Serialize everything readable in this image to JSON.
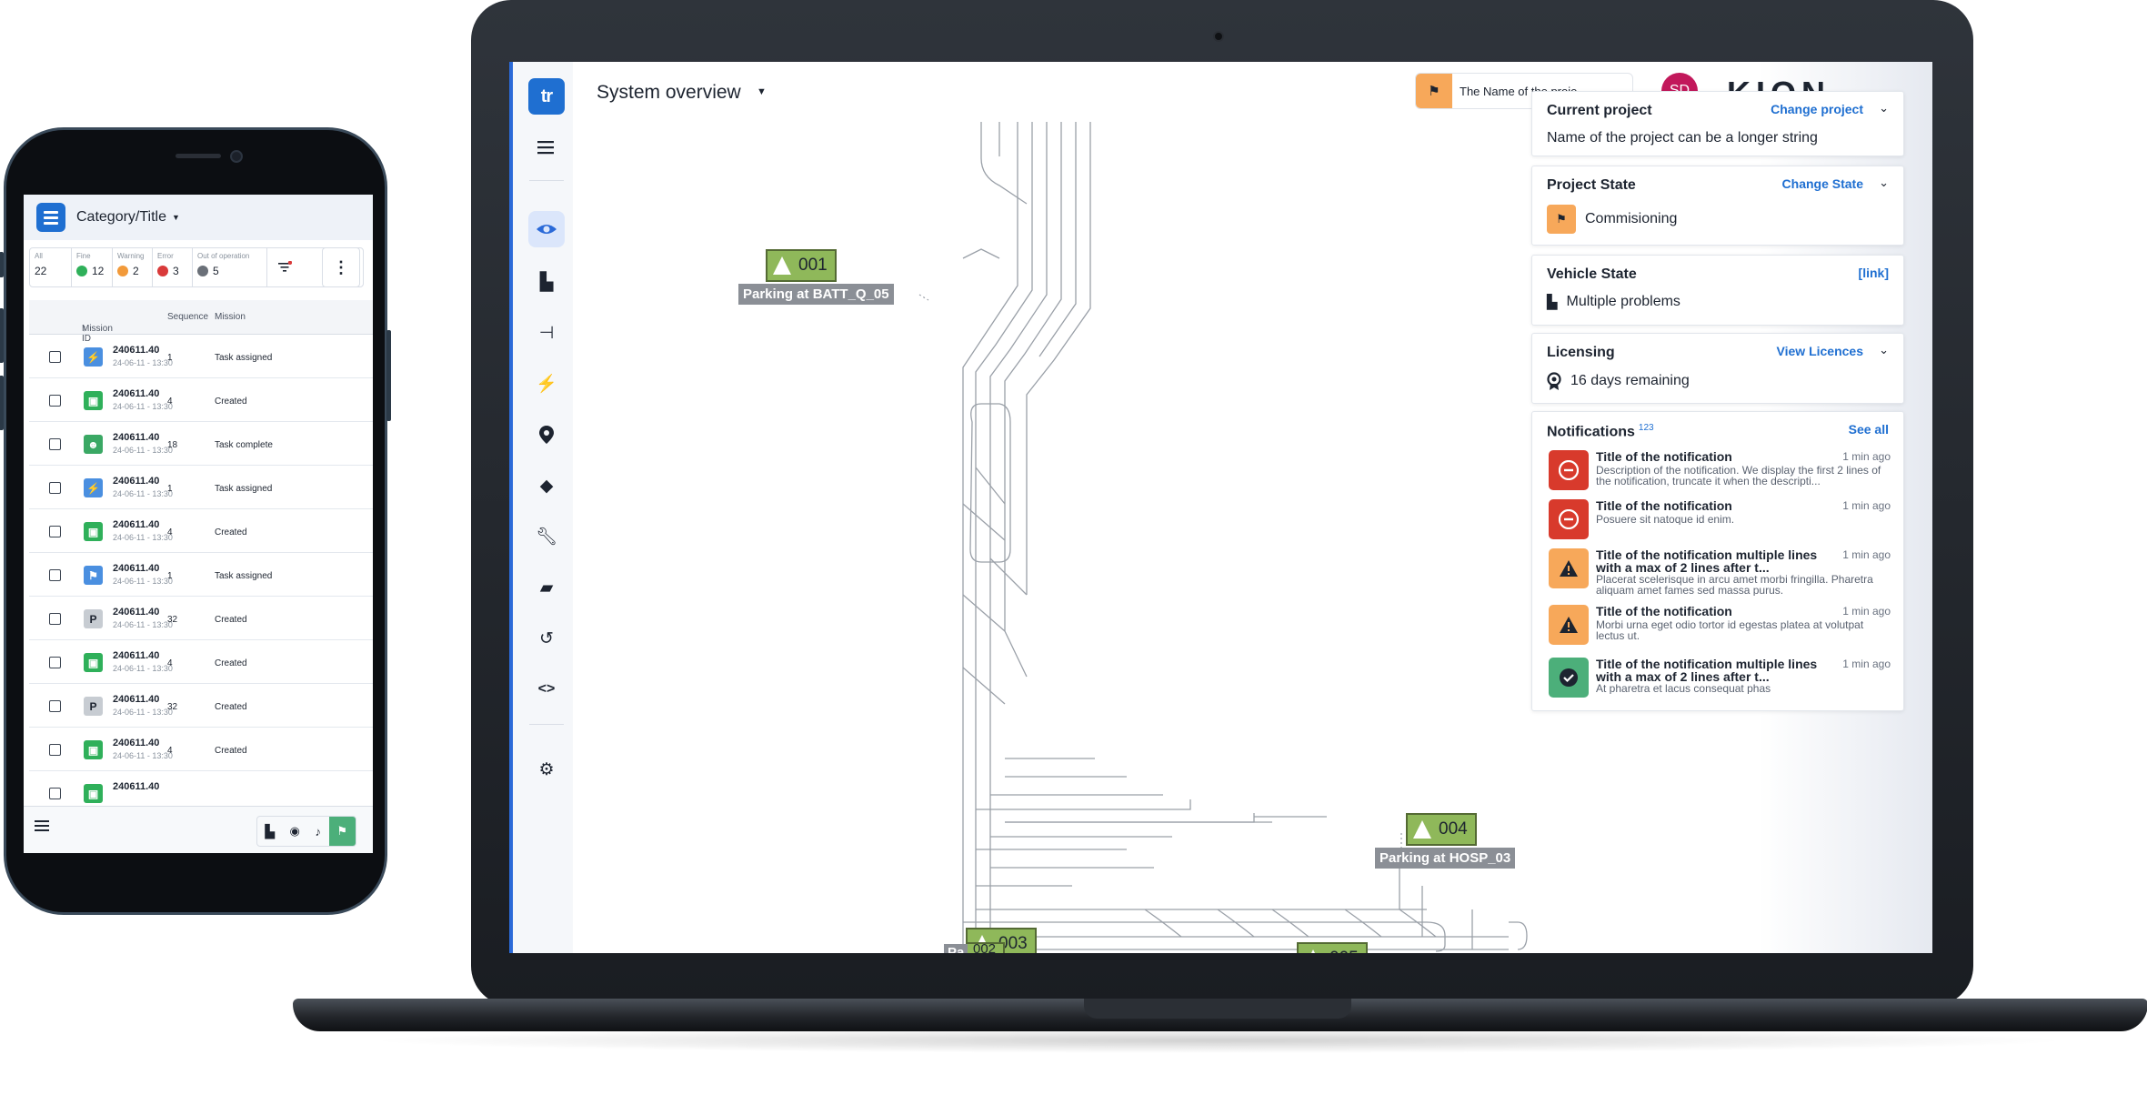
{
  "phone": {
    "header": {
      "title": "Category/Title"
    },
    "stats": [
      {
        "label": "All",
        "value": "22",
        "color": ""
      },
      {
        "label": "Fine",
        "value": "12",
        "color": "#2fb05a"
      },
      {
        "label": "Warning",
        "value": "2",
        "color": "#f29a3a"
      },
      {
        "label": "Error",
        "value": "3",
        "color": "#d93a3a"
      },
      {
        "label": "Out of operation",
        "value": "5",
        "color": "#6a7078"
      }
    ],
    "table": {
      "headers": {
        "mission_id": "Mission ID",
        "sequence": "Sequence",
        "mission": "Mission"
      },
      "rows": [
        {
          "id": "240611.40",
          "date": "24-06-11 - 13:30",
          "seq": "1",
          "mission": "Task assigned",
          "icon": "bolt-icon",
          "color": "#4a8fe0",
          "glyph": "⚡"
        },
        {
          "id": "240611.40",
          "date": "24-06-11 - 13:30",
          "seq": "4",
          "mission": "Created",
          "icon": "charging-icon",
          "color": "#2fb05a",
          "glyph": "▣"
        },
        {
          "id": "240611.40",
          "date": "24-06-11 - 13:30",
          "seq": "18",
          "mission": "Task complete",
          "icon": "robot-icon",
          "color": "#3aa864",
          "glyph": "☻"
        },
        {
          "id": "240611.40",
          "date": "24-06-11 - 13:30",
          "seq": "1",
          "mission": "Task assigned",
          "icon": "bolt-icon",
          "color": "#4a8fe0",
          "glyph": "⚡"
        },
        {
          "id": "240611.40",
          "date": "24-06-11 - 13:30",
          "seq": "4",
          "mission": "Created",
          "icon": "charging-icon",
          "color": "#2fb05a",
          "glyph": "▣"
        },
        {
          "id": "240611.40",
          "date": "24-06-11 - 13:30",
          "seq": "1",
          "mission": "Task assigned",
          "icon": "plug-icon",
          "color": "#4a8fe0",
          "glyph": "⚑"
        },
        {
          "id": "240611.40",
          "date": "24-06-11 - 13:30",
          "seq": "32",
          "mission": "Created",
          "icon": "parking-icon",
          "color": "#c7ccd2",
          "glyph": "P"
        },
        {
          "id": "240611.40",
          "date": "24-06-11 - 13:30",
          "seq": "4",
          "mission": "Created",
          "icon": "charging-icon",
          "color": "#2fb05a",
          "glyph": "▣"
        },
        {
          "id": "240611.40",
          "date": "24-06-11 - 13:30",
          "seq": "32",
          "mission": "Created",
          "icon": "parking-icon",
          "color": "#c7ccd2",
          "glyph": "P"
        },
        {
          "id": "240611.40",
          "date": "24-06-11 - 13:30",
          "seq": "4",
          "mission": "Created",
          "icon": "charging-icon",
          "color": "#2fb05a",
          "glyph": "▣"
        },
        {
          "id": "240611.40",
          "date": "",
          "seq": "",
          "mission": "",
          "icon": "charging-icon",
          "color": "#2fb05a",
          "glyph": "▣"
        }
      ]
    }
  },
  "laptop": {
    "logo_text": "tr",
    "page_title": "System overview",
    "project_chip": "The Name of the proje",
    "avatar_initials": "SD",
    "brand": "KION",
    "vehicles": [
      {
        "id": "001",
        "label": "Parking at BATT_Q_05"
      },
      {
        "id": "004",
        "label": "Parking at HOSP_03"
      },
      {
        "id": "003",
        "label": ""
      },
      {
        "id": "002",
        "label": "Pa"
      },
      {
        "id": "005",
        "label": ""
      }
    ],
    "panel": {
      "current_project": {
        "title": "Current project",
        "link": "Change project",
        "body": "Name of the project can be a  longer string"
      },
      "project_state": {
        "title": "Project State",
        "link": "Change State",
        "body": "Commisioning"
      },
      "vehicle_state": {
        "title": "Vehicle State",
        "link": "[link]",
        "body": "Multiple problems"
      },
      "licensing": {
        "title": "Licensing",
        "link": "View Licences",
        "body": "16 days remaining"
      },
      "notifications": {
        "title": "Notifications",
        "count": "123",
        "link": "See all",
        "items": [
          {
            "type": "error",
            "title": "Title of the notification",
            "desc": "Description of the notification. We display the first 2 lines of the notification, truncate it when the descripti...",
            "time": "1 min ago"
          },
          {
            "type": "error",
            "title": "Title of the notification",
            "desc": "Posuere sit natoque id enim.",
            "time": "1 min ago"
          },
          {
            "type": "warning",
            "title": "Title of the notification multiple lines with a max of 2 lines after t...",
            "desc": "Placerat scelerisque in arcu amet morbi fringilla. Pharetra aliquam amet fames sed massa purus.",
            "time": "1 min ago"
          },
          {
            "type": "warning",
            "title": "Title of the notification",
            "desc": "Morbi urna eget odio tortor id egestas platea at volutpat lectus ut.",
            "time": "1 min ago"
          },
          {
            "type": "success",
            "title": "Title of the notification multiple lines with a max of 2 lines after t...",
            "desc": "At pharetra et lacus consequat phas",
            "time": "1 min ago"
          }
        ]
      }
    }
  }
}
